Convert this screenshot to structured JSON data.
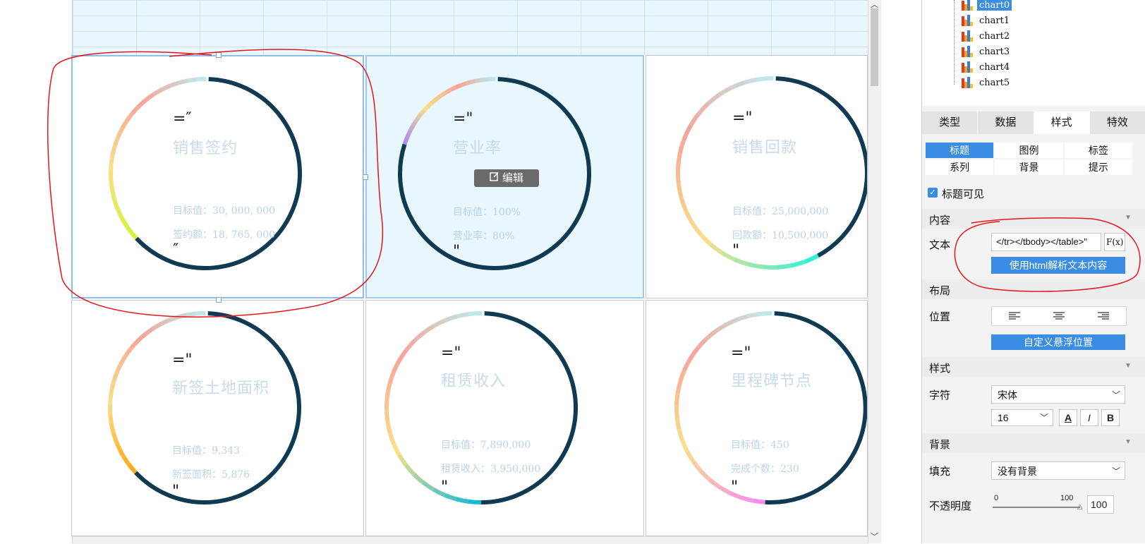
{
  "charts": [
    {
      "quote_open": "=″",
      "title": "销售签约",
      "line1": "目标值：30, 000, 000",
      "line2": "签约额：18, 765, 000",
      "quote_close": "″",
      "accent": "#d4f23b",
      "progress": 0.63
    },
    {
      "quote_open": "=\"",
      "title": "营业率",
      "line1": "目标值：100%",
      "line2": "营业率：80%",
      "quote_close": "\"",
      "accent": "#a98bf5",
      "progress": 0.8
    },
    {
      "quote_open": "=\"",
      "title": "销售回款",
      "line1": "目标值：25,000,000",
      "line2": "回款额：10,500,000",
      "quote_close": "\"",
      "accent": "#32f0d8",
      "progress": 0.42
    },
    {
      "quote_open": "=\"",
      "title": "新签土地面积",
      "line1": "目标值：9,343",
      "line2": "新签面积：5,876",
      "quote_close": "\"",
      "accent": "#ffa81e",
      "progress": 0.63
    },
    {
      "quote_open": "=\"",
      "title": "租赁收入",
      "line1": "目标值：7,890,000",
      "line2": "租赁收入：3,950,000",
      "quote_close": "\"",
      "accent": "#15b9d6",
      "progress": 0.5
    },
    {
      "quote_open": "=\"",
      "title": "里程碑节点",
      "line1": "目标值：450",
      "line2": "完成个数：230",
      "quote_close": "\"",
      "accent": "#f78cf0",
      "progress": 0.51
    }
  ],
  "edit_button": {
    "label": "编辑",
    "icon": "edit-icon"
  },
  "tree": {
    "items": [
      "chart0",
      "chart1",
      "chart2",
      "chart3",
      "chart4",
      "chart5"
    ],
    "selected": "chart0"
  },
  "tabs": [
    {
      "label": "类型",
      "active": false
    },
    {
      "label": "数据",
      "active": false
    },
    {
      "label": "样式",
      "active": true
    },
    {
      "label": "特效",
      "active": false
    }
  ],
  "subtabs": [
    {
      "label": "标题",
      "active": true
    },
    {
      "label": "图例",
      "active": false
    },
    {
      "label": "标签",
      "active": false
    },
    {
      "label": "系列",
      "active": false
    },
    {
      "label": "背景",
      "active": false
    },
    {
      "label": "提示",
      "active": false
    }
  ],
  "title_visible": {
    "label": "标题可见",
    "checked": true
  },
  "content": {
    "section": "内容",
    "text_label": "文本",
    "text_value": "</tr></tbody></table>\"",
    "formula_btn": "F(x)",
    "html_btn": "使用html解析文本内容"
  },
  "layout": {
    "section": "布局",
    "position_label": "位置",
    "align_icons": [
      "align-left-icon",
      "align-center-icon",
      "align-right-icon"
    ],
    "float_btn": "自定义悬浮位置"
  },
  "style": {
    "section": "样式",
    "char_label": "字符",
    "font_value": "宋体",
    "size_value": "16",
    "format_buttons": [
      "A",
      "I",
      "B"
    ]
  },
  "background": {
    "section": "背景",
    "fill_label": "填充",
    "fill_value": "没有背景",
    "opacity_label": "不透明度",
    "opacity_min": "0",
    "opacity_max": "100",
    "opacity_value": "100"
  },
  "colors": {
    "ring_dark": "#0f3a52",
    "accent_blue": "#3b8de4",
    "annotation_red": "#e8141c"
  }
}
